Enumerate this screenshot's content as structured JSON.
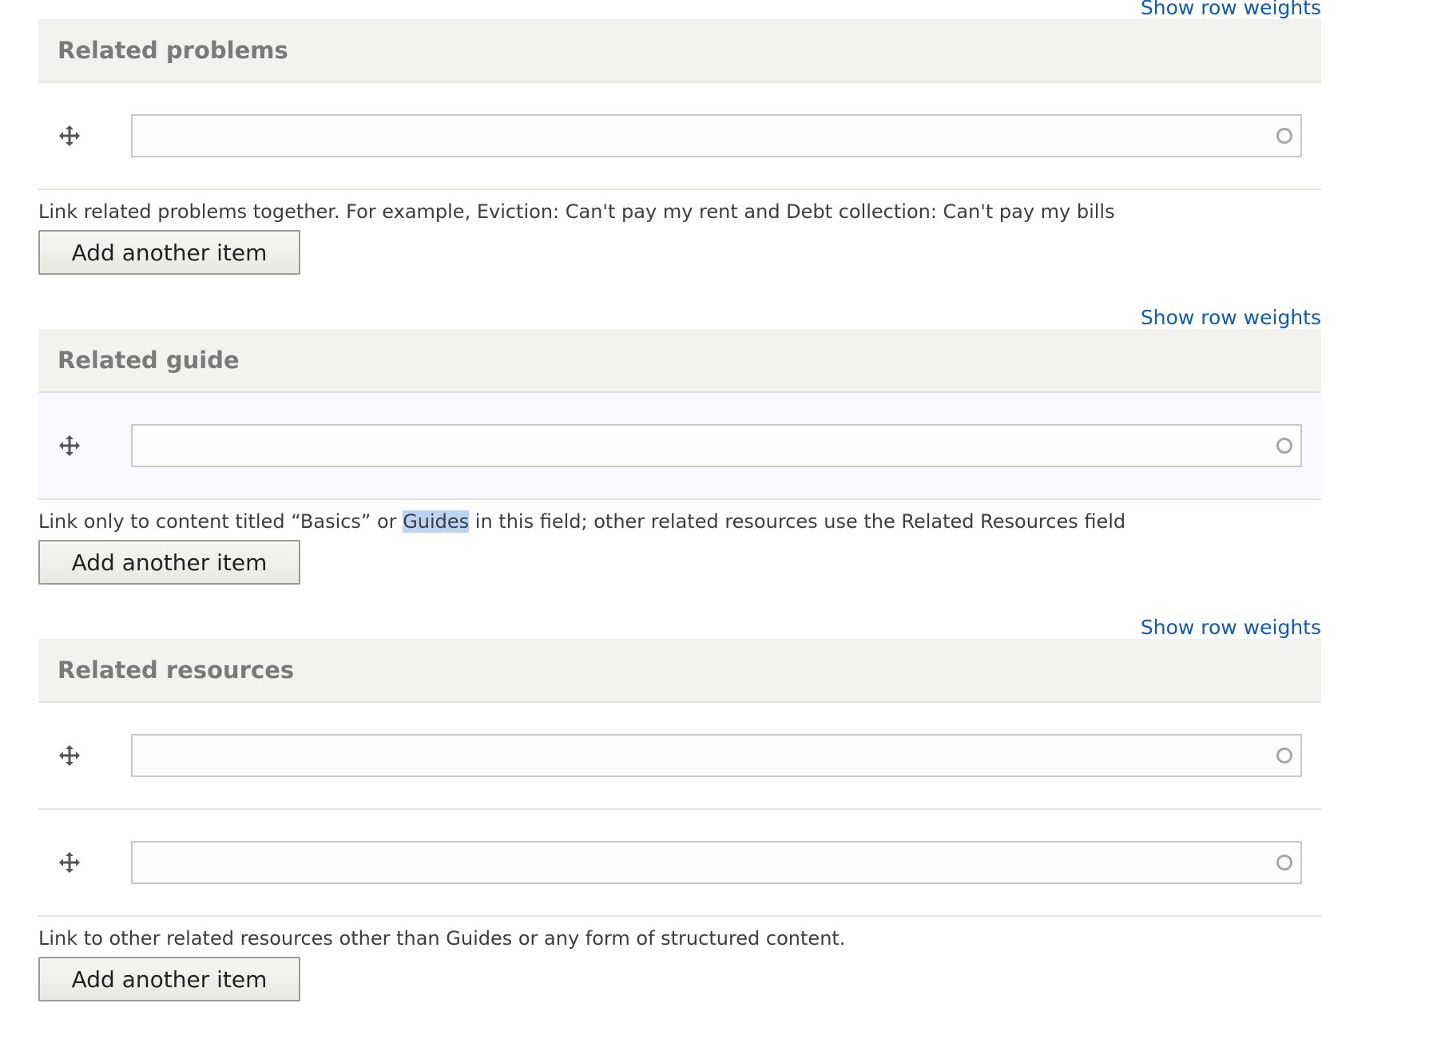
{
  "sections": [
    {
      "weights_link": "Show row weights",
      "title": "Related problems",
      "inputs": [
        {
          "value": ""
        }
      ],
      "description": "Link related problems together. For example, Eviction: Can't pay my rent and Debt collection: Can't pay my bills",
      "add_button": "Add another item"
    },
    {
      "weights_link": "Show row weights",
      "title": "Related guide",
      "inputs": [
        {
          "value": ""
        }
      ],
      "description_before": "Link only to content titled “Basics” or ",
      "description_highlight": "Guides",
      "description_after": " in this field; other related resources use the Related Resources field",
      "add_button": "Add another item"
    },
    {
      "weights_link": "Show row weights",
      "title": "Related resources",
      "inputs": [
        {
          "value": ""
        },
        {
          "value": ""
        }
      ],
      "description": "Link to other related resources other than Guides or any form of structured content.",
      "add_button": "Add another item"
    }
  ],
  "icons": {
    "drag": "move-arrows-icon",
    "autocomplete": "throbber-circle-icon"
  },
  "colors": {
    "link": "#0d5cb6",
    "header_bg": "#f2f2ee",
    "highlight": "#bcd4f4"
  }
}
